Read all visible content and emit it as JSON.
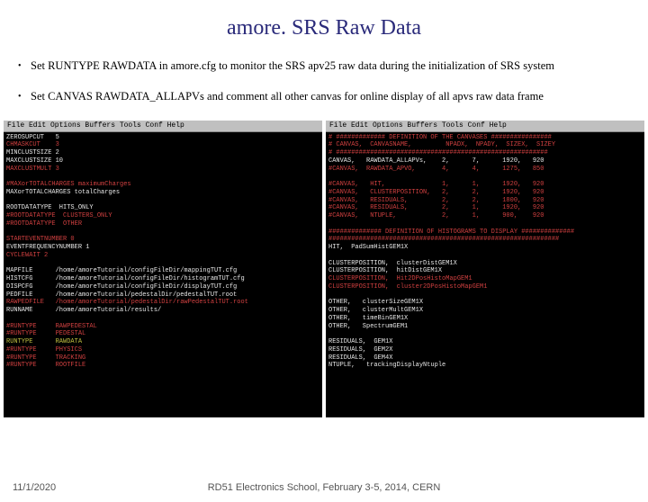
{
  "slide": {
    "title": "amore. SRS Raw Data",
    "bullets": [
      "Set RUNTYPE RAWDATA  in amore.cfg to monitor the  SRS apv25 raw data during the initialization of SRS system",
      "Set CANVAS RAWDATA_ALLAPVs and comment all other canvas for online display of all apvs raw data frame"
    ]
  },
  "term_left": {
    "menubar": "File Edit Options Buffers Tools Conf Help",
    "lines": [
      {
        "cls": "white",
        "t": "ZEROSUPCUT   5"
      },
      {
        "cls": "red",
        "t": "CHMASKCUT    3"
      },
      {
        "cls": "white",
        "t": "MINCLUSTSIZE 2"
      },
      {
        "cls": "white",
        "t": "MAXCLUSTSIZE 10"
      },
      {
        "cls": "red",
        "t": "MAXCLUSTMULT 3"
      },
      {
        "cls": "white",
        "t": ""
      },
      {
        "cls": "red",
        "t": "#MAXorTOTALCHARGES maximumCharges"
      },
      {
        "cls": "white",
        "t": "MAXorTOTALCHARGES totalCharges"
      },
      {
        "cls": "white",
        "t": ""
      },
      {
        "cls": "white",
        "t": "ROOTDATATYPE  HITS_ONLY"
      },
      {
        "cls": "red",
        "t": "#ROOTDATATYPE  CLUSTERS_ONLY"
      },
      {
        "cls": "red",
        "t": "#ROOTDATATYPE  OTHER"
      },
      {
        "cls": "white",
        "t": ""
      },
      {
        "cls": "red",
        "t": "STARTEVENTNUMBER 0"
      },
      {
        "cls": "white",
        "t": "EVENTFREQUENCYNUMBER 1"
      },
      {
        "cls": "red",
        "t": "CYCLEWAIT 2"
      },
      {
        "cls": "white",
        "t": ""
      },
      {
        "cls": "white",
        "t": "MAPFILE      /home/amoreTutorial/configFileDir/mappingTUT.cfg"
      },
      {
        "cls": "white",
        "t": "HISTCFG      /home/amoreTutorial/configFileDir/histogramTUT.cfg"
      },
      {
        "cls": "white",
        "t": "DISPCFG      /home/amoreTutorial/configFileDir/displayTUT.cfg"
      },
      {
        "cls": "white",
        "t": "PEDFILE      /home/amoreTutorial/pedestalDir/pedestalTUT.root"
      },
      {
        "cls": "red",
        "t": "RAWPEDFILE   /home/amoreTutorial/pedestalDir/rawPedestalTUT.root"
      },
      {
        "cls": "white",
        "t": "RUNNAME      /home/amoreTutorial/results/"
      },
      {
        "cls": "white",
        "t": ""
      },
      {
        "cls": "red",
        "t": "#RUNTYPE     RAWPEDESTAL"
      },
      {
        "cls": "red",
        "t": "#RUNTYPE     PEDESTAL"
      },
      {
        "cls": "yellow",
        "t": "RUNTYPE      RAWDATA"
      },
      {
        "cls": "red",
        "t": "#RUNTYPE     PHYSICS"
      },
      {
        "cls": "red",
        "t": "#RUNTYPE     TRACKING"
      },
      {
        "cls": "red",
        "t": "#RUNTYPE     ROOTFILE"
      }
    ]
  },
  "term_right": {
    "menubar": "File Edit Options Buffers Tools Conf Help",
    "lines": [
      {
        "cls": "red",
        "t": "# ############# DEFINITION OF THE CANVASES ################"
      },
      {
        "cls": "red",
        "t": "# CANVAS,  CANVASNAME,         NPADX,  NPADY,  SIZEX,  SIZEY"
      },
      {
        "cls": "red",
        "t": "# ########################################################"
      },
      {
        "cls": "white",
        "t": "CANVAS,   RAWDATA_ALLAPVs,    2,      7,      1920,   920"
      },
      {
        "cls": "red",
        "t": "#CANVAS,  RAWDATA_APVO,       4,      4,      1275,   850"
      },
      {
        "cls": "white",
        "t": ""
      },
      {
        "cls": "red",
        "t": "#CANVAS,   HIT,               1,      1,      1920,   920"
      },
      {
        "cls": "red",
        "t": "#CANVAS,   CLUSTERPOSITION,   2,      2,      1920,   920"
      },
      {
        "cls": "red",
        "t": "#CANVAS,   RESIDUALS,         2,      2,      1800,   920"
      },
      {
        "cls": "red",
        "t": "#CANVAS,   RESIDUALS,         2,      1,      1920,   920"
      },
      {
        "cls": "red",
        "t": "#CANVAS,   NTUPLE,            2,      1,      900,    920"
      },
      {
        "cls": "white",
        "t": ""
      },
      {
        "cls": "red",
        "t": "############## DEFINITION OF HISTOGRAMS TO DISPLAY ##############"
      },
      {
        "cls": "red",
        "t": "#############################################################"
      },
      {
        "cls": "white",
        "t": "HIT,  PadSumHistGEM1X"
      },
      {
        "cls": "white",
        "t": ""
      },
      {
        "cls": "white",
        "t": "CLUSTERPOSITION,  clusterDistGEM1X"
      },
      {
        "cls": "white",
        "t": "CLUSTERPOSITION,  hitDistGEM1X"
      },
      {
        "cls": "red",
        "t": "CLUSTERPOSITION,  Hit2DPosHistoMapGEM1"
      },
      {
        "cls": "red",
        "t": "CLUSTERPOSITION,  cluster2DPosHistoMapGEM1"
      },
      {
        "cls": "white",
        "t": ""
      },
      {
        "cls": "white",
        "t": "OTHER,   clusterSizeGEM1X"
      },
      {
        "cls": "white",
        "t": "OTHER,   clusterMultGEM1X"
      },
      {
        "cls": "white",
        "t": "OTHER,   timeBinGEM1X"
      },
      {
        "cls": "white",
        "t": "OTHER,   SpectrumGEM1"
      },
      {
        "cls": "white",
        "t": ""
      },
      {
        "cls": "white",
        "t": "RESIDUALS,  GEM1X"
      },
      {
        "cls": "white",
        "t": "RESIDUALS,  GEM2X"
      },
      {
        "cls": "white",
        "t": "RESIDUALS,  GEM4X"
      },
      {
        "cls": "white",
        "t": "NTUPLE,   trackingDisplayNtuple"
      }
    ]
  },
  "footer": {
    "date": "11/1/2020",
    "center": "RD51 Electronics School, February 3-5, 2014, CERN"
  }
}
